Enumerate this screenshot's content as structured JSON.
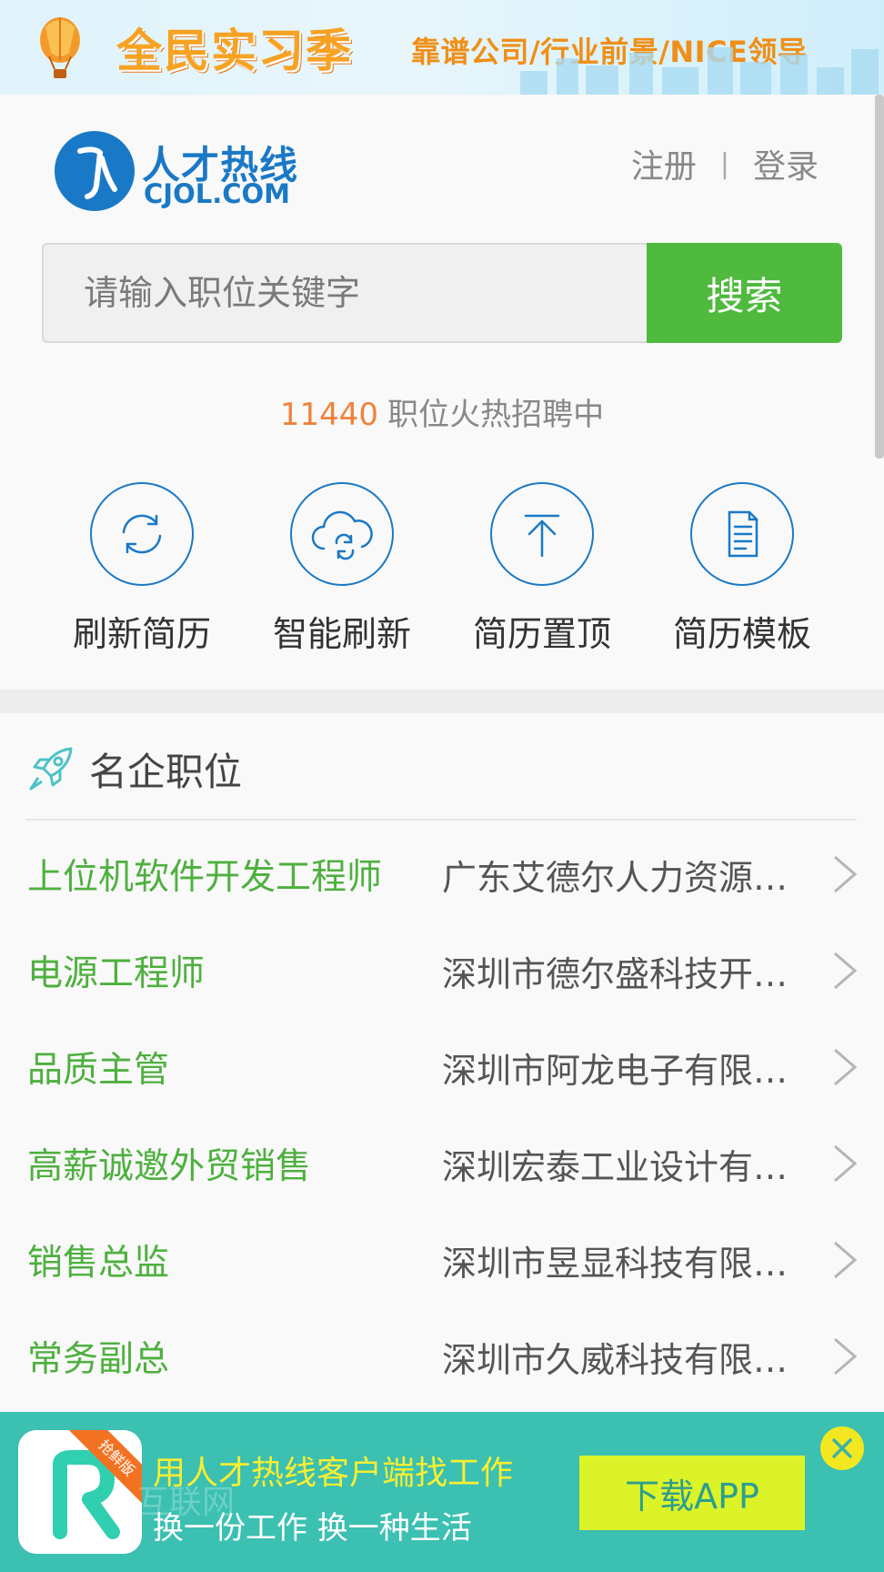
{
  "banner": {
    "slogan": "全民实习季",
    "tagline": "靠谱公司/行业前景/NICE领导"
  },
  "header": {
    "logo_cn": "人才热线",
    "logo_en": "CJOL.COM",
    "register": "注册",
    "separator": "|",
    "login": "登录"
  },
  "search": {
    "placeholder": "请输入职位关键字",
    "button": "搜索"
  },
  "hot": {
    "count": "11440",
    "text": "职位火热招聘中"
  },
  "actions": [
    {
      "label": "刷新简历",
      "icon": "refresh-icon"
    },
    {
      "label": "智能刷新",
      "icon": "cloud-refresh-icon"
    },
    {
      "label": "简历置顶",
      "icon": "arrow-top-icon"
    },
    {
      "label": "简历模板",
      "icon": "document-icon"
    }
  ],
  "section": {
    "title": "名企职位",
    "icon": "rocket-icon"
  },
  "jobs": [
    {
      "title": "上位机软件开发工程师",
      "company": "广东艾德尔人力资源…"
    },
    {
      "title": "电源工程师",
      "company": "深圳市德尔盛科技开…"
    },
    {
      "title": "品质主管",
      "company": "深圳市阿龙电子有限…"
    },
    {
      "title": "高薪诚邀外贸销售",
      "company": "深圳宏泰工业设计有…"
    },
    {
      "title": "销售总监",
      "company": "深圳市昱显科技有限…"
    },
    {
      "title": "常务副总",
      "company": "深圳市久威科技有限…"
    }
  ],
  "appbar": {
    "ribbon": "抢鲜版",
    "title": "用人才热线客户端找工作",
    "subtitle": "换一份工作 换一种生活",
    "watermark": "互联网",
    "download": "下载APP"
  },
  "colors": {
    "brand_blue": "#1a79c6",
    "green": "#4fba3e",
    "orange": "#f0823a",
    "teal": "#3bc0b1"
  }
}
